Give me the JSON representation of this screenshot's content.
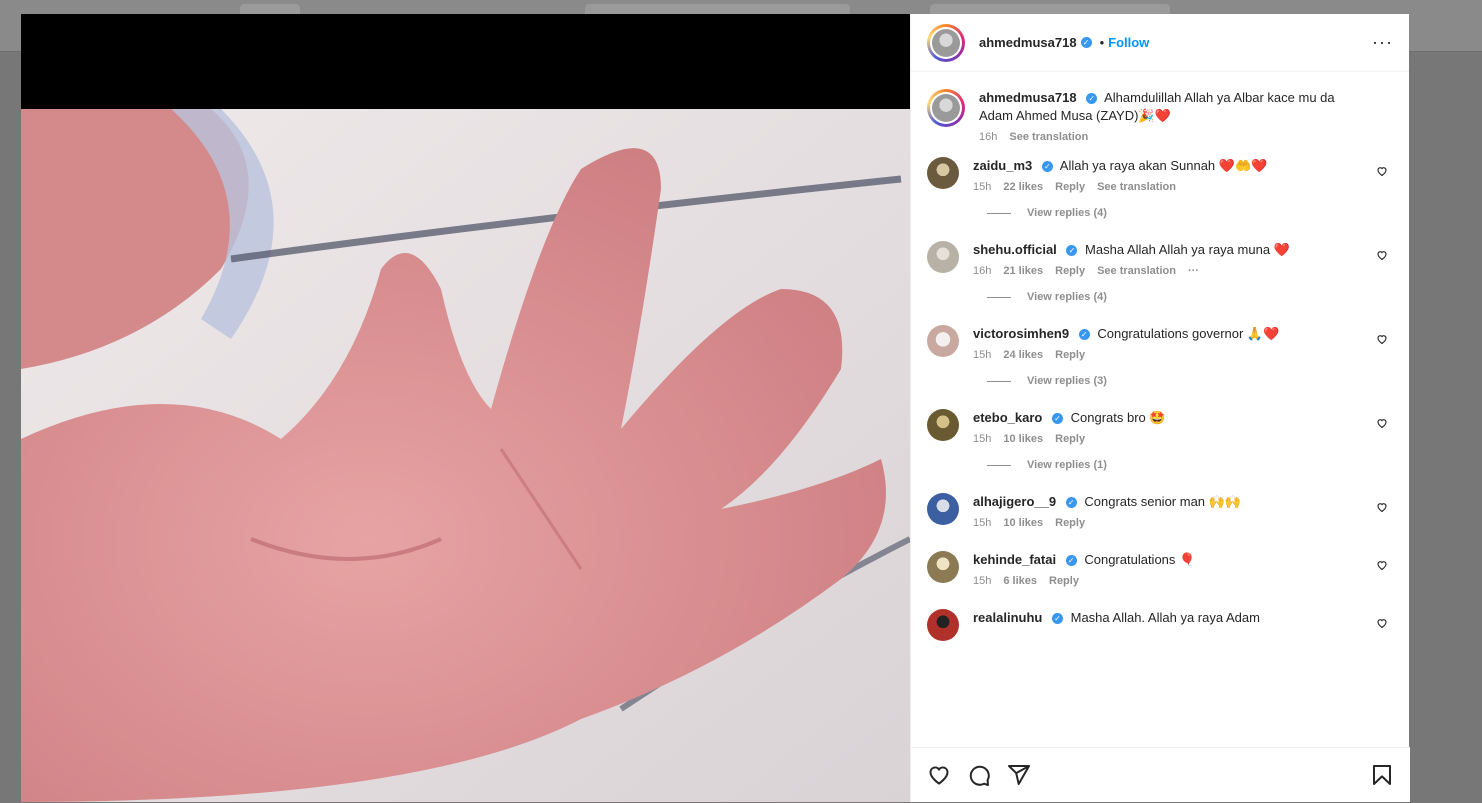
{
  "post": {
    "author": "ahmedmusa718",
    "follow_label": "Follow",
    "dot": "•",
    "more_label": "···"
  },
  "caption": {
    "username": "ahmedmusa718",
    "text": "Alhamdulillah Allah ya Albar kace mu da Adam Ahmed Musa (ZAYD)🎉❤️",
    "time": "16h",
    "see_translation": "See translation"
  },
  "comments": [
    {
      "username": "zaidu_m3",
      "text": "Allah ya raya akan Sunnah ❤️🤲❤️",
      "time": "15h",
      "likes": "22 likes",
      "reply": "Reply",
      "extra": "See translation",
      "view_replies": "View replies (4)",
      "avatar_color": "#6b5a3e"
    },
    {
      "username": "shehu.official",
      "text": "Masha Allah Allah ya raya muna ❤️",
      "time": "16h",
      "likes": "21 likes",
      "reply": "Reply",
      "extra": "See translation",
      "extra2": "···",
      "view_replies": "View replies (4)",
      "avatar_color": "#b8b2a6"
    },
    {
      "username": "victorosimhen9",
      "text": "Congratulations governor 🙏❤️",
      "time": "15h",
      "likes": "24 likes",
      "reply": "Reply",
      "view_replies": "View replies (3)",
      "avatar_color": "#c9a8a0"
    },
    {
      "username": "etebo_karo",
      "text": "Congrats bro 🤩",
      "time": "15h",
      "likes": "10 likes",
      "reply": "Reply",
      "view_replies": "View replies (1)",
      "avatar_color": "#6a5a32"
    },
    {
      "username": "alhajigero__9",
      "text": "Congrats senior man 🙌🙌",
      "time": "15h",
      "likes": "10 likes",
      "reply": "Reply",
      "avatar_color": "#3b5fa0"
    },
    {
      "username": "kehinde_fatai",
      "text": "Congratulations 🎈",
      "time": "15h",
      "likes": "6 likes",
      "reply": "Reply",
      "avatar_color": "#8c7a55"
    },
    {
      "username": "realalinuhu",
      "text": "Masha Allah. Allah ya raya Adam",
      "avatar_color": "#b0302a"
    }
  ],
  "colors": {
    "verified": "#3897f0",
    "link": "#0095f6",
    "muted": "#8e8e8e"
  }
}
